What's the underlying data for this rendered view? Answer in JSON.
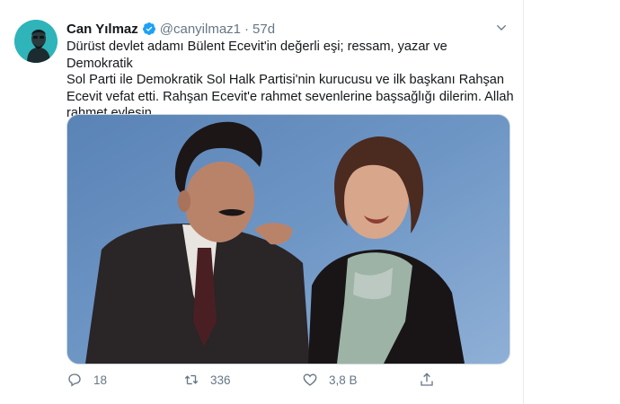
{
  "tweet": {
    "display_name": "Can Yılmaz",
    "handle": "@canyilmaz1",
    "separator": "·",
    "time": "57d",
    "text_lines": [
      "Dürüst devlet adamı Bülent Ecevit'in değerli eşi; ressam, yazar ve Demokratik",
      "Sol Parti ile Demokratik Sol Halk Partisi'nin kurucusu ve ilk başkanı Rahşan",
      "Ecevit vefat etti. Rahşan Ecevit'e rahmet sevenlerine başsağlığı dilerim. Allah",
      "rahmet eylesin."
    ],
    "counts": {
      "replies": "18",
      "retweets": "336",
      "likes": "3,8 B"
    }
  },
  "icons": {
    "verified": "verified-badge-icon",
    "more": "chevron-down-icon",
    "reply": "reply-icon",
    "retweet": "retweet-icon",
    "like": "heart-icon",
    "share": "share-icon"
  },
  "colors": {
    "verified": "#1da1f2",
    "muted": "#657786",
    "text": "#14171a",
    "avatar_bg": "#2fb4b9",
    "photo_bg": "#6f97c6"
  }
}
